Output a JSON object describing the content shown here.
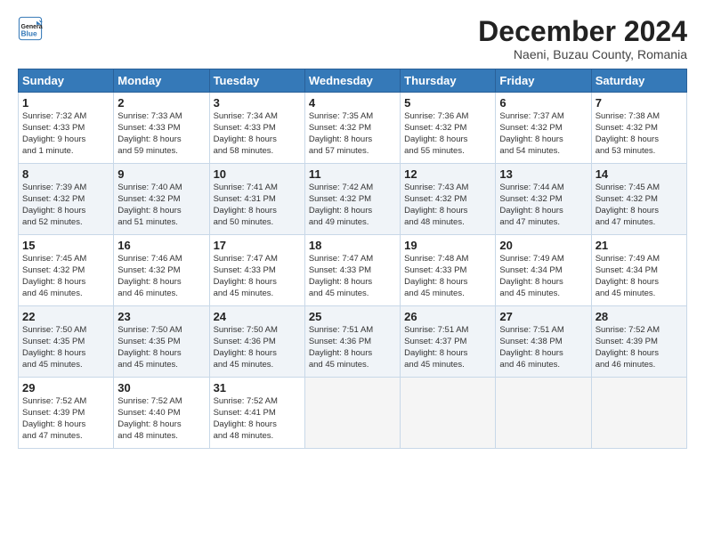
{
  "header": {
    "logo_line1": "General",
    "logo_line2": "Blue",
    "month": "December 2024",
    "location": "Naeni, Buzau County, Romania"
  },
  "days_of_week": [
    "Sunday",
    "Monday",
    "Tuesday",
    "Wednesday",
    "Thursday",
    "Friday",
    "Saturday"
  ],
  "weeks": [
    [
      {
        "day": "1",
        "info": "Sunrise: 7:32 AM\nSunset: 4:33 PM\nDaylight: 9 hours\nand 1 minute."
      },
      {
        "day": "2",
        "info": "Sunrise: 7:33 AM\nSunset: 4:33 PM\nDaylight: 8 hours\nand 59 minutes."
      },
      {
        "day": "3",
        "info": "Sunrise: 7:34 AM\nSunset: 4:33 PM\nDaylight: 8 hours\nand 58 minutes."
      },
      {
        "day": "4",
        "info": "Sunrise: 7:35 AM\nSunset: 4:32 PM\nDaylight: 8 hours\nand 57 minutes."
      },
      {
        "day": "5",
        "info": "Sunrise: 7:36 AM\nSunset: 4:32 PM\nDaylight: 8 hours\nand 55 minutes."
      },
      {
        "day": "6",
        "info": "Sunrise: 7:37 AM\nSunset: 4:32 PM\nDaylight: 8 hours\nand 54 minutes."
      },
      {
        "day": "7",
        "info": "Sunrise: 7:38 AM\nSunset: 4:32 PM\nDaylight: 8 hours\nand 53 minutes."
      }
    ],
    [
      {
        "day": "8",
        "info": "Sunrise: 7:39 AM\nSunset: 4:32 PM\nDaylight: 8 hours\nand 52 minutes."
      },
      {
        "day": "9",
        "info": "Sunrise: 7:40 AM\nSunset: 4:32 PM\nDaylight: 8 hours\nand 51 minutes."
      },
      {
        "day": "10",
        "info": "Sunrise: 7:41 AM\nSunset: 4:31 PM\nDaylight: 8 hours\nand 50 minutes."
      },
      {
        "day": "11",
        "info": "Sunrise: 7:42 AM\nSunset: 4:32 PM\nDaylight: 8 hours\nand 49 minutes."
      },
      {
        "day": "12",
        "info": "Sunrise: 7:43 AM\nSunset: 4:32 PM\nDaylight: 8 hours\nand 48 minutes."
      },
      {
        "day": "13",
        "info": "Sunrise: 7:44 AM\nSunset: 4:32 PM\nDaylight: 8 hours\nand 47 minutes."
      },
      {
        "day": "14",
        "info": "Sunrise: 7:45 AM\nSunset: 4:32 PM\nDaylight: 8 hours\nand 47 minutes."
      }
    ],
    [
      {
        "day": "15",
        "info": "Sunrise: 7:45 AM\nSunset: 4:32 PM\nDaylight: 8 hours\nand 46 minutes."
      },
      {
        "day": "16",
        "info": "Sunrise: 7:46 AM\nSunset: 4:32 PM\nDaylight: 8 hours\nand 46 minutes."
      },
      {
        "day": "17",
        "info": "Sunrise: 7:47 AM\nSunset: 4:33 PM\nDaylight: 8 hours\nand 45 minutes."
      },
      {
        "day": "18",
        "info": "Sunrise: 7:47 AM\nSunset: 4:33 PM\nDaylight: 8 hours\nand 45 minutes."
      },
      {
        "day": "19",
        "info": "Sunrise: 7:48 AM\nSunset: 4:33 PM\nDaylight: 8 hours\nand 45 minutes."
      },
      {
        "day": "20",
        "info": "Sunrise: 7:49 AM\nSunset: 4:34 PM\nDaylight: 8 hours\nand 45 minutes."
      },
      {
        "day": "21",
        "info": "Sunrise: 7:49 AM\nSunset: 4:34 PM\nDaylight: 8 hours\nand 45 minutes."
      }
    ],
    [
      {
        "day": "22",
        "info": "Sunrise: 7:50 AM\nSunset: 4:35 PM\nDaylight: 8 hours\nand 45 minutes."
      },
      {
        "day": "23",
        "info": "Sunrise: 7:50 AM\nSunset: 4:35 PM\nDaylight: 8 hours\nand 45 minutes."
      },
      {
        "day": "24",
        "info": "Sunrise: 7:50 AM\nSunset: 4:36 PM\nDaylight: 8 hours\nand 45 minutes."
      },
      {
        "day": "25",
        "info": "Sunrise: 7:51 AM\nSunset: 4:36 PM\nDaylight: 8 hours\nand 45 minutes."
      },
      {
        "day": "26",
        "info": "Sunrise: 7:51 AM\nSunset: 4:37 PM\nDaylight: 8 hours\nand 45 minutes."
      },
      {
        "day": "27",
        "info": "Sunrise: 7:51 AM\nSunset: 4:38 PM\nDaylight: 8 hours\nand 46 minutes."
      },
      {
        "day": "28",
        "info": "Sunrise: 7:52 AM\nSunset: 4:39 PM\nDaylight: 8 hours\nand 46 minutes."
      }
    ],
    [
      {
        "day": "29",
        "info": "Sunrise: 7:52 AM\nSunset: 4:39 PM\nDaylight: 8 hours\nand 47 minutes."
      },
      {
        "day": "30",
        "info": "Sunrise: 7:52 AM\nSunset: 4:40 PM\nDaylight: 8 hours\nand 48 minutes."
      },
      {
        "day": "31",
        "info": "Sunrise: 7:52 AM\nSunset: 4:41 PM\nDaylight: 8 hours\nand 48 minutes."
      },
      null,
      null,
      null,
      null
    ]
  ]
}
